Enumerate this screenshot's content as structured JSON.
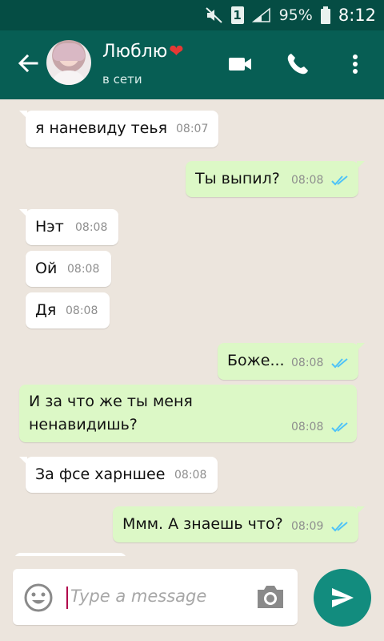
{
  "status_bar": {
    "sim": "1",
    "battery": "95%",
    "time": "8:12"
  },
  "header": {
    "contact_name": "Люблю",
    "status": "в сети"
  },
  "messages": [
    {
      "dir": "in",
      "text": "я наневиду теья",
      "time": "08:07"
    },
    {
      "dir": "out",
      "text": "Ты выпил?",
      "time": "08:08"
    },
    {
      "dir": "in",
      "text": "Нэт",
      "time": "08:08"
    },
    {
      "dir": "in",
      "text": "Ой",
      "time": "08:08"
    },
    {
      "dir": "in",
      "text": "Дя",
      "time": "08:08"
    },
    {
      "dir": "out",
      "text": "Боже...",
      "time": "08:08"
    },
    {
      "dir": "out",
      "text": "И за что же ты меня\nненавидишь?",
      "time": "08:08"
    },
    {
      "dir": "in",
      "text": "За фсе харншее",
      "time": "08:08"
    },
    {
      "dir": "out",
      "text": "Ммм. А знаешь что?",
      "time": "08:09"
    }
  ],
  "input": {
    "placeholder": "Type a message"
  },
  "colors": {
    "header": "#075e54",
    "status_bar": "#054d44",
    "out_bubble": "#dcf8c6",
    "in_bubble": "#ffffff",
    "chat_bg": "#ece5dd",
    "read_ticks": "#4fc3f7",
    "send_button": "#128c7e"
  },
  "icons": {
    "back": "arrow-left-icon",
    "video": "video-call-icon",
    "call": "phone-icon",
    "menu": "more-vert-icon",
    "emoji": "emoji-icon",
    "camera": "camera-icon",
    "send": "send-icon"
  }
}
